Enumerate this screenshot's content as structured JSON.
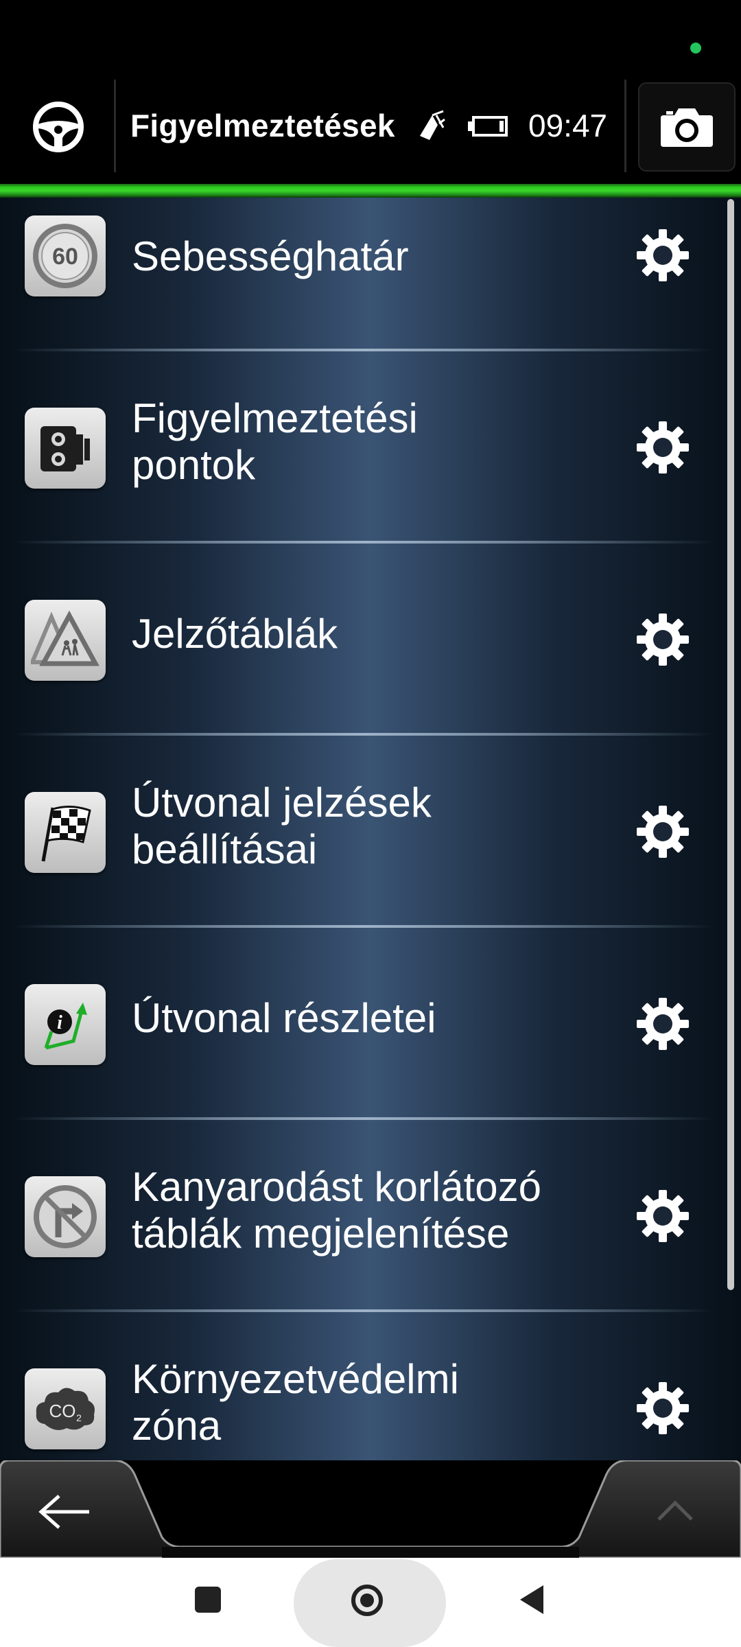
{
  "header": {
    "title": "Figyelmeztetések",
    "clock": "09:47"
  },
  "items": [
    {
      "label": "Sebességhatár",
      "icon": "speed-limit-60-icon",
      "icon_text": "60"
    },
    {
      "label_line1": "Figyelmeztetési",
      "label_line2": "pontok",
      "icon": "speed-camera-icon"
    },
    {
      "label": "Jelzőtáblák",
      "icon": "warning-signs-icon"
    },
    {
      "label_line1": "Útvonal jelzések",
      "label_line2": "beállításai",
      "icon": "checkered-flag-icon"
    },
    {
      "label": "Útvonal részletei",
      "icon": "route-info-icon"
    },
    {
      "label_line1": "Kanyarodást korlátozó",
      "label_line2": "táblák megjelenítése",
      "icon": "no-right-turn-icon"
    },
    {
      "label_line1": "Környezetvédelmi",
      "label_line2": "zóna",
      "icon": "co2-zone-icon",
      "icon_text": "CO2"
    }
  ],
  "colors": {
    "accent": "#39d82b",
    "status_dot": "#22c55e"
  }
}
